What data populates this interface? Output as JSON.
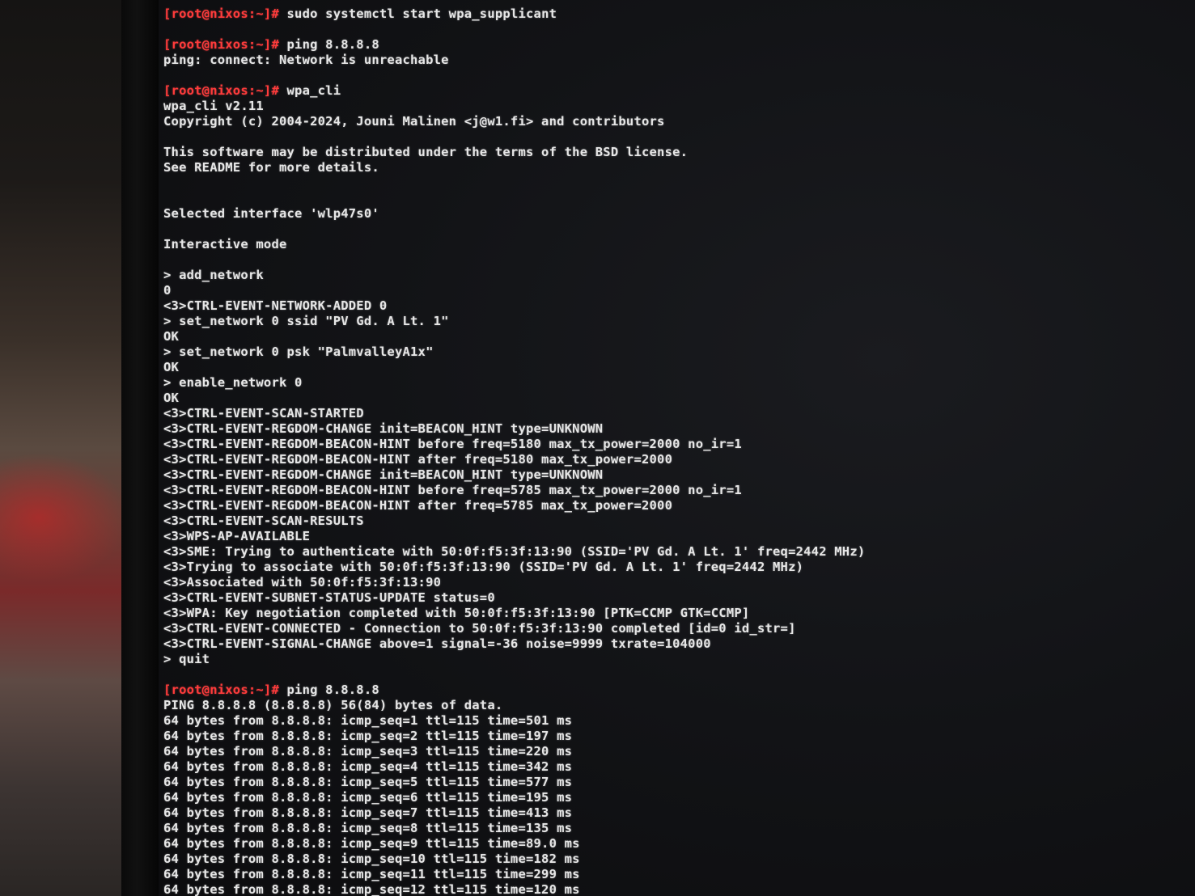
{
  "prompt": "[root@nixos:~]#",
  "colors": {
    "prompt": "#ff3b3b",
    "text": "#e6e6e6",
    "background": "#121316"
  },
  "lines": [
    {
      "prompt": true,
      "cmd": " sudo systemctl start wpa_supplicant"
    },
    {
      "blank": true
    },
    {
      "prompt": true,
      "cmd": " ping 8.8.8.8"
    },
    {
      "text": "ping: connect: Network is unreachable"
    },
    {
      "blank": true
    },
    {
      "prompt": true,
      "cmd": " wpa_cli"
    },
    {
      "text": "wpa_cli v2.11"
    },
    {
      "text": "Copyright (c) 2004-2024, Jouni Malinen <j@w1.fi> and contributors"
    },
    {
      "blank": true
    },
    {
      "text": "This software may be distributed under the terms of the BSD license."
    },
    {
      "text": "See README for more details."
    },
    {
      "blank": true
    },
    {
      "blank": true
    },
    {
      "text": "Selected interface 'wlp47s0'"
    },
    {
      "blank": true
    },
    {
      "text": "Interactive mode"
    },
    {
      "blank": true
    },
    {
      "text": "> add_network"
    },
    {
      "text": "0"
    },
    {
      "text": "<3>CTRL-EVENT-NETWORK-ADDED 0"
    },
    {
      "text": "> set_network 0 ssid \"PV Gd. A Lt. 1\""
    },
    {
      "text": "OK"
    },
    {
      "text": "> set_network 0 psk \"PalmvalleyA1x\""
    },
    {
      "text": "OK"
    },
    {
      "text": "> enable_network 0"
    },
    {
      "text": "OK"
    },
    {
      "text": "<3>CTRL-EVENT-SCAN-STARTED"
    },
    {
      "text": "<3>CTRL-EVENT-REGDOM-CHANGE init=BEACON_HINT type=UNKNOWN"
    },
    {
      "text": "<3>CTRL-EVENT-REGDOM-BEACON-HINT before freq=5180 max_tx_power=2000 no_ir=1"
    },
    {
      "text": "<3>CTRL-EVENT-REGDOM-BEACON-HINT after freq=5180 max_tx_power=2000"
    },
    {
      "text": "<3>CTRL-EVENT-REGDOM-CHANGE init=BEACON_HINT type=UNKNOWN"
    },
    {
      "text": "<3>CTRL-EVENT-REGDOM-BEACON-HINT before freq=5785 max_tx_power=2000 no_ir=1"
    },
    {
      "text": "<3>CTRL-EVENT-REGDOM-BEACON-HINT after freq=5785 max_tx_power=2000"
    },
    {
      "text": "<3>CTRL-EVENT-SCAN-RESULTS"
    },
    {
      "text": "<3>WPS-AP-AVAILABLE"
    },
    {
      "text": "<3>SME: Trying to authenticate with 50:0f:f5:3f:13:90 (SSID='PV Gd. A Lt. 1' freq=2442 MHz)"
    },
    {
      "text": "<3>Trying to associate with 50:0f:f5:3f:13:90 (SSID='PV Gd. A Lt. 1' freq=2442 MHz)"
    },
    {
      "text": "<3>Associated with 50:0f:f5:3f:13:90"
    },
    {
      "text": "<3>CTRL-EVENT-SUBNET-STATUS-UPDATE status=0"
    },
    {
      "text": "<3>WPA: Key negotiation completed with 50:0f:f5:3f:13:90 [PTK=CCMP GTK=CCMP]"
    },
    {
      "text": "<3>CTRL-EVENT-CONNECTED - Connection to 50:0f:f5:3f:13:90 completed [id=0 id_str=]"
    },
    {
      "text": "<3>CTRL-EVENT-SIGNAL-CHANGE above=1 signal=-36 noise=9999 txrate=104000"
    },
    {
      "text": "> quit"
    },
    {
      "blank": true
    },
    {
      "prompt": true,
      "cmd": " ping 8.8.8.8"
    },
    {
      "text": "PING 8.8.8.8 (8.8.8.8) 56(84) bytes of data."
    },
    {
      "text": "64 bytes from 8.8.8.8: icmp_seq=1 ttl=115 time=501 ms"
    },
    {
      "text": "64 bytes from 8.8.8.8: icmp_seq=2 ttl=115 time=197 ms"
    },
    {
      "text": "64 bytes from 8.8.8.8: icmp_seq=3 ttl=115 time=220 ms"
    },
    {
      "text": "64 bytes from 8.8.8.8: icmp_seq=4 ttl=115 time=342 ms"
    },
    {
      "text": "64 bytes from 8.8.8.8: icmp_seq=5 ttl=115 time=577 ms"
    },
    {
      "text": "64 bytes from 8.8.8.8: icmp_seq=6 ttl=115 time=195 ms"
    },
    {
      "text": "64 bytes from 8.8.8.8: icmp_seq=7 ttl=115 time=413 ms"
    },
    {
      "text": "64 bytes from 8.8.8.8: icmp_seq=8 ttl=115 time=135 ms"
    },
    {
      "text": "64 bytes from 8.8.8.8: icmp_seq=9 ttl=115 time=89.0 ms"
    },
    {
      "text": "64 bytes from 8.8.8.8: icmp_seq=10 ttl=115 time=182 ms"
    },
    {
      "text": "64 bytes from 8.8.8.8: icmp_seq=11 ttl=115 time=299 ms"
    },
    {
      "text": "64 bytes from 8.8.8.8: icmp_seq=12 ttl=115 time=120 ms"
    }
  ]
}
